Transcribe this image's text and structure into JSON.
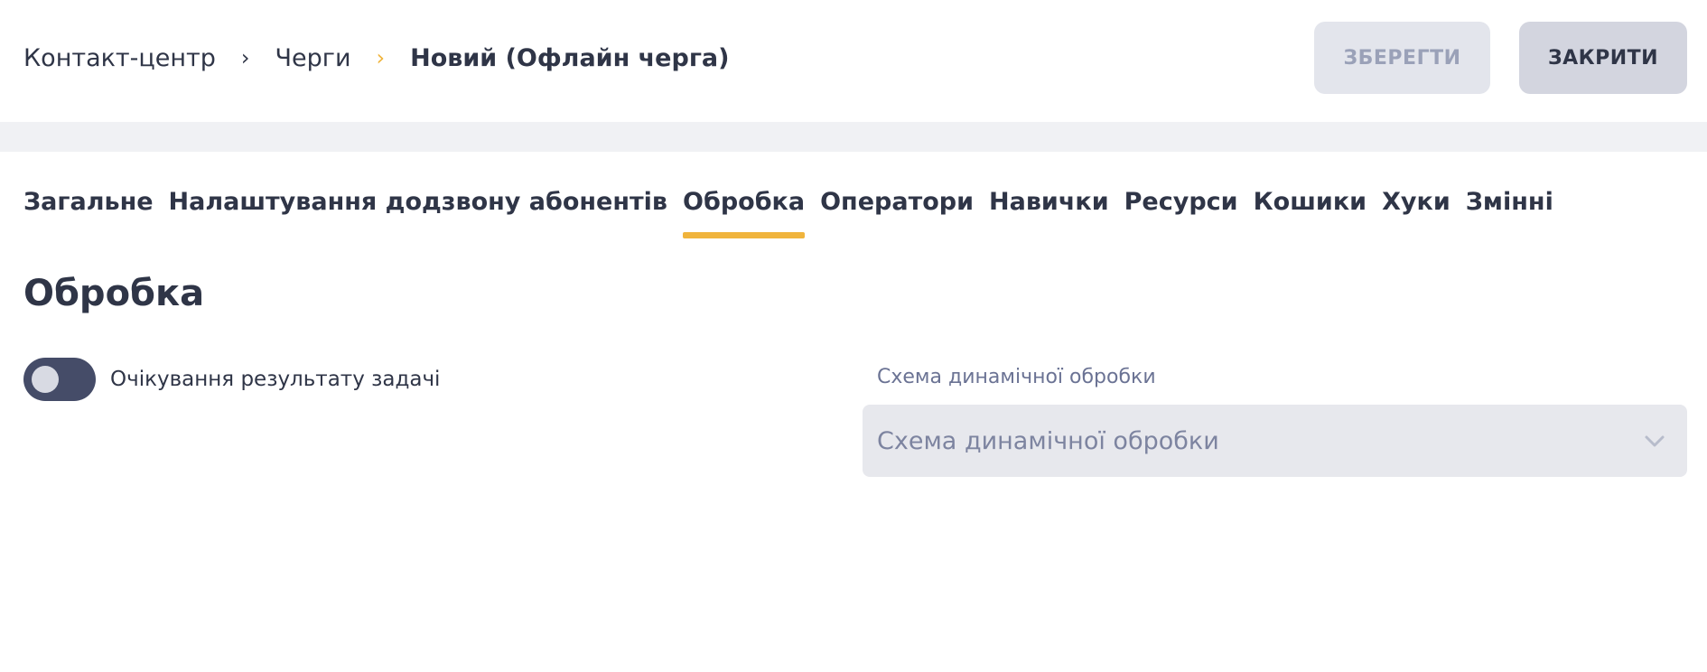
{
  "breadcrumb": {
    "items": [
      "Контакт-центр",
      "Черги",
      "Новий (Офлайн черга)"
    ]
  },
  "toolbar": {
    "save_label": "ЗБЕРЕГТИ",
    "close_label": "ЗАКРИТИ"
  },
  "tabs": [
    {
      "label": "Загальне"
    },
    {
      "label": "Налаштування додзвону абонентів"
    },
    {
      "label": "Обробка",
      "active": true
    },
    {
      "label": "Оператори"
    },
    {
      "label": "Навички"
    },
    {
      "label": "Ресурси"
    },
    {
      "label": "Кошики"
    },
    {
      "label": "Хуки"
    },
    {
      "label": "Змінні"
    }
  ],
  "section": {
    "title": "Обробка"
  },
  "task_result_toggle": {
    "label": "Очікування результату задачі",
    "enabled": false
  },
  "dynamic_scheme": {
    "label": "Схема динамічної обробки",
    "placeholder": "Схема динамічної обробки"
  },
  "colors": {
    "accent": "#f0b43c",
    "text": "#2f3547",
    "muted": "#7d84a0",
    "toggle_bg": "#454c68"
  }
}
